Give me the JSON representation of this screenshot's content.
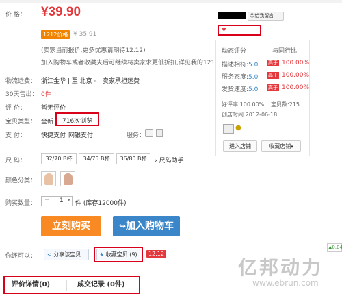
{
  "price": {
    "label": "价  格：",
    "value": "¥39.90"
  },
  "promo": {
    "tag": "1212价格",
    "old_price": "¥ 35.91"
  },
  "notes": [
    "(卖家当前报价,更多优惠请期待12.12)",
    "加入购物车或者收藏夹后可继续将卖家求更低折扣,详见我的1212"
  ],
  "shipping": {
    "label": "物流运费：",
    "route": "浙江金华 | 至 北京 ·",
    "note": "卖家承担运费"
  },
  "sales": {
    "label": "30天售出：",
    "value": "0件"
  },
  "rating": {
    "label": "评    价：",
    "value": "暂无评价"
  },
  "item_type": {
    "label": "宝贝类型：",
    "value": "全新",
    "views": "716次浏览"
  },
  "payment": {
    "label": "支    付：",
    "methods": [
      "快捷支付",
      "网银支付"
    ],
    "service_label": "服务："
  },
  "size": {
    "label": "尺    码：",
    "options": [
      "32/70 B杯",
      "34/75 B杯",
      "36/80 B杯"
    ],
    "helper": "尺码助手"
  },
  "color": {
    "label": "颜色分类："
  },
  "quantity": {
    "label": "购买数量：",
    "value": "1",
    "stock": "件 (库存12000件)"
  },
  "actions": {
    "buy": "立刻购买",
    "cart": "加入购物车"
  },
  "share": {
    "label": "你还可以：",
    "share_btn": "分享该宝贝",
    "fav_btn": "收藏宝贝 (9)",
    "badge": "12.12"
  },
  "tabs": [
    "评价详情(0)",
    "成交记录 (0件)"
  ],
  "seller": {
    "contact": "给我留言",
    "dynamic_title": "动态评分",
    "compare_title": "与同行比",
    "scores": [
      {
        "name": "描述相符:",
        "score": "5.0",
        "tag": "高于",
        "pct": "100.00%"
      },
      {
        "name": "服务态度:",
        "score": "5.0",
        "tag": "高于",
        "pct": "100.00%"
      },
      {
        "name": "发货速度:",
        "score": "5.0",
        "tag": "高于",
        "pct": "100.00%"
      }
    ],
    "good_rate": "好评率:100.00%",
    "item_count": "宝贝数:215",
    "created": "创店时间:2012-06-18",
    "enter_shop": "进入店铺",
    "fav_shop": "收藏店铺"
  },
  "side_tag": "0.04",
  "watermark": {
    "brand": "亿邦动力",
    "url": "www.ebrun.com"
  }
}
